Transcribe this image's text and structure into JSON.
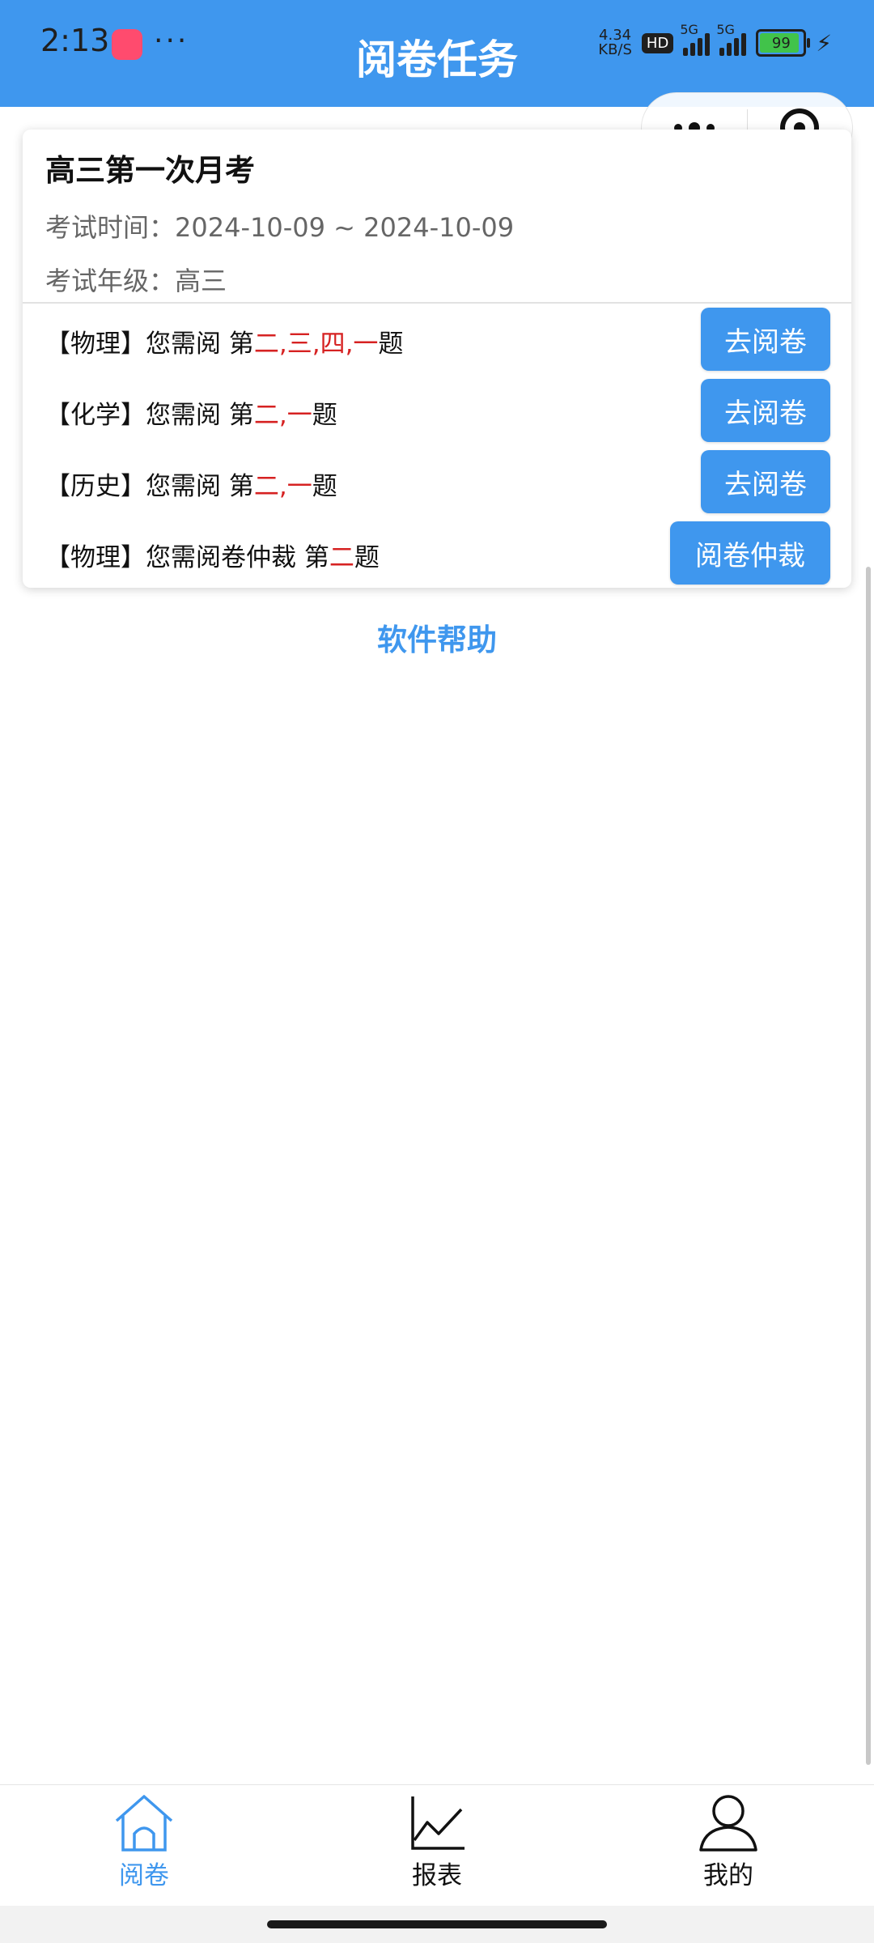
{
  "status_bar": {
    "time": "2:13",
    "dots": "···",
    "net_speed": "4.34\nKB/S",
    "hd": "HD",
    "sig1": "5G",
    "sig2": "5G",
    "battery": "99"
  },
  "header": {
    "title": "阅卷任务"
  },
  "exam": {
    "title": "高三第一次月考",
    "time": "考试时间：2024-10-09 ~ 2024-10-09",
    "grade": "考试年级：高三"
  },
  "tasks": [
    {
      "prefix": "【物理】您需阅 第",
      "questions": "二,三,四,一",
      "suffix": "题",
      "button": "去阅卷"
    },
    {
      "prefix": "【化学】您需阅 第",
      "questions": "二,一",
      "suffix": "题",
      "button": "去阅卷"
    },
    {
      "prefix": "【历史】您需阅 第",
      "questions": "二,一",
      "suffix": "题",
      "button": "去阅卷"
    },
    {
      "prefix": "【物理】您需阅卷仲裁 第",
      "questions": "二",
      "suffix": "题",
      "button": "阅卷仲裁"
    }
  ],
  "help_link": "软件帮助",
  "tabbar": {
    "tabs": [
      {
        "label": "阅卷",
        "icon": "home-icon",
        "active": true
      },
      {
        "label": "报表",
        "icon": "chart-icon",
        "active": false
      },
      {
        "label": "我的",
        "icon": "user-icon",
        "active": false
      }
    ]
  },
  "colors": {
    "accent": "#3f97ee",
    "highlight": "#d62222"
  }
}
